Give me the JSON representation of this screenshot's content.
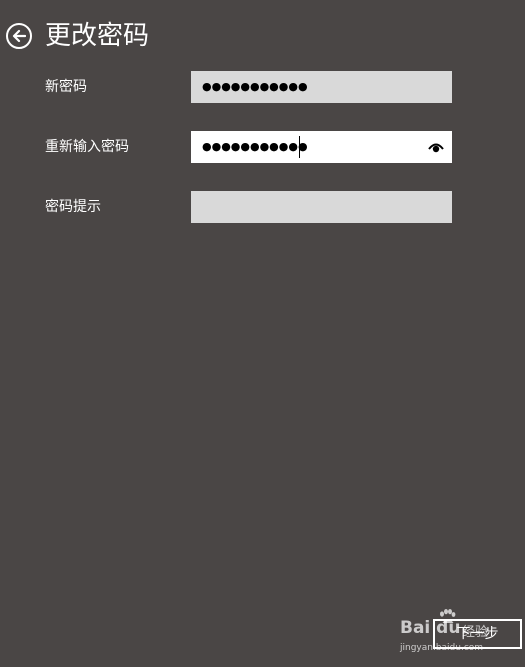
{
  "header": {
    "title": "更改密码",
    "back_icon": "back-arrow-icon"
  },
  "form": {
    "new_password": {
      "label": "新密码",
      "masked_value": "●●●●●●●●●●●"
    },
    "confirm_password": {
      "label": "重新输入密码",
      "masked_value": "●●●●●●●●●●●",
      "reveal_icon": "eye-icon"
    },
    "password_hint": {
      "label": "密码提示",
      "value": ""
    }
  },
  "footer": {
    "next_label": "下一步"
  },
  "watermark": {
    "brand_text": "Bai du",
    "brand_sub": "经验",
    "url": "jingyan.baidu.com"
  },
  "colors": {
    "background": "#4a4645",
    "input_inactive": "#d9d9d9",
    "input_focused": "#ffffff",
    "text": "#ffffff"
  }
}
